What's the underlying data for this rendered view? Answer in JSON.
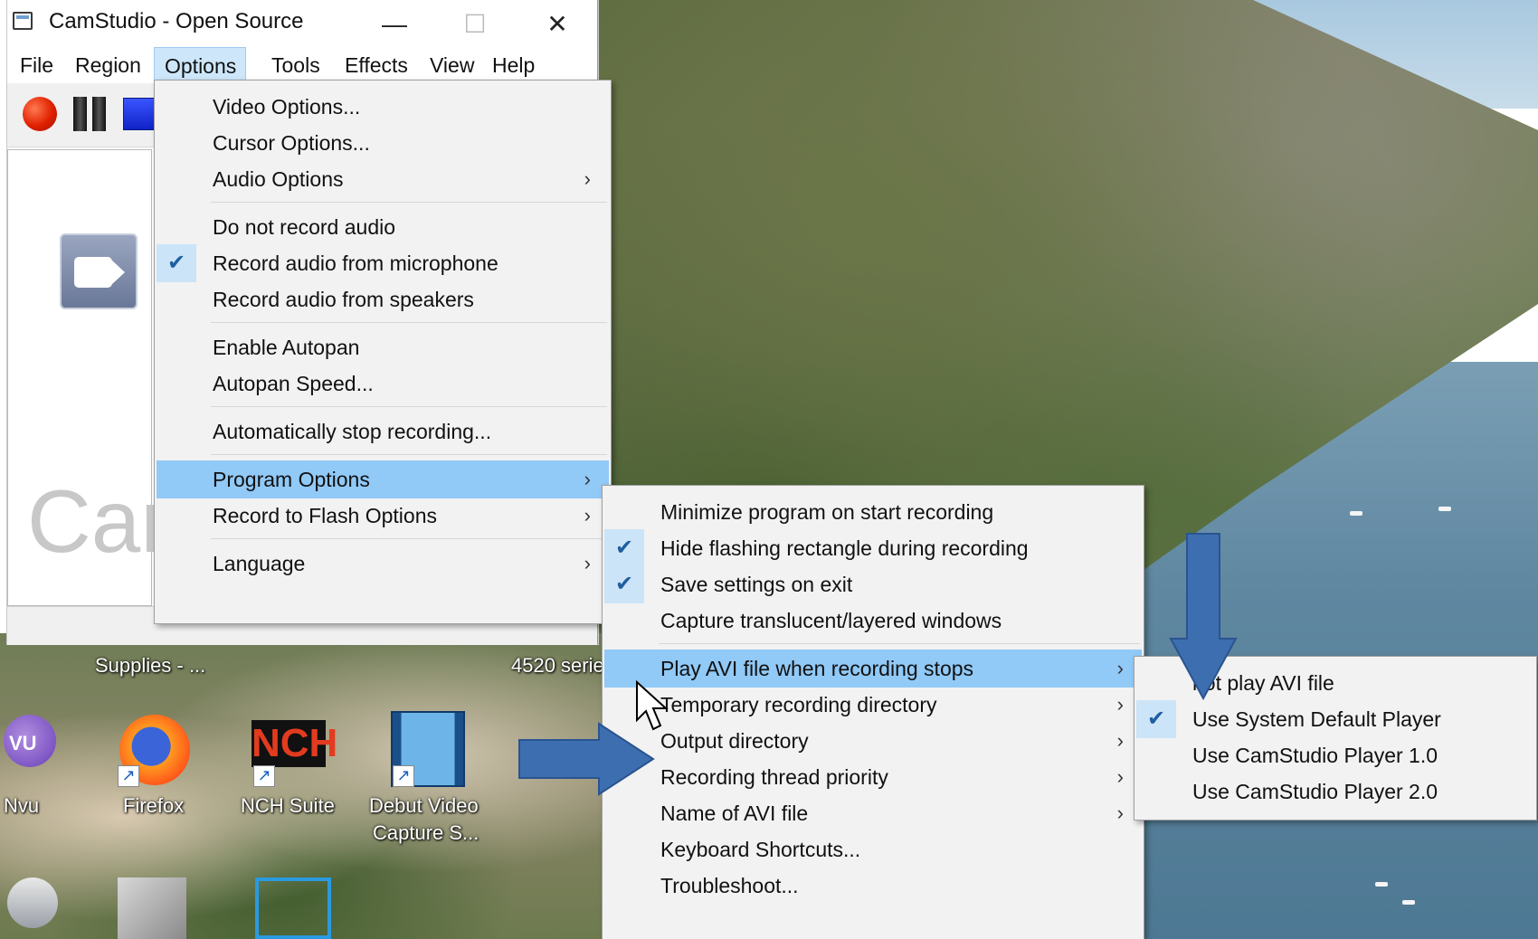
{
  "window": {
    "title": "CamStudio - Open Source",
    "minimize_glyph": "—",
    "maximize_glyph": "☐",
    "close_glyph": "✕"
  },
  "menubar": [
    "File",
    "Region",
    "Options",
    "Tools",
    "Effects",
    "View",
    "Help"
  ],
  "background_text": "Car",
  "desktop": {
    "partial_labels": [
      "Supplies - ...",
      "4520 serie",
      "Nvu",
      "Firefox",
      "NCH Suite",
      "Debut Video",
      "Capture S..."
    ],
    "nch_logo_text": "NCH"
  },
  "options_menu": {
    "items": [
      {
        "label": "Video Options...",
        "checked": false,
        "submenu": false
      },
      {
        "label": "Cursor Options...",
        "checked": false,
        "submenu": false
      },
      {
        "label": "Audio Options",
        "checked": false,
        "submenu": true
      },
      {
        "label": "Do not record audio",
        "checked": false,
        "submenu": false
      },
      {
        "label": "Record audio from microphone",
        "checked": true,
        "submenu": false
      },
      {
        "label": "Record audio from speakers",
        "checked": false,
        "submenu": false
      },
      {
        "label": "Enable Autopan",
        "checked": false,
        "submenu": false
      },
      {
        "label": "Autopan Speed...",
        "checked": false,
        "submenu": false
      },
      {
        "label": "Automatically stop recording...",
        "checked": false,
        "submenu": false
      },
      {
        "label": "Program Options",
        "checked": false,
        "submenu": true,
        "highlighted": true
      },
      {
        "label": "Record to Flash Options",
        "checked": false,
        "submenu": true
      },
      {
        "label": "Language",
        "checked": false,
        "submenu": true
      }
    ]
  },
  "program_options_menu": {
    "items": [
      {
        "label": "Minimize program on start recording",
        "checked": false,
        "submenu": false
      },
      {
        "label": "Hide flashing rectangle during recording",
        "checked": true,
        "submenu": false
      },
      {
        "label": "Save settings on exit",
        "checked": true,
        "submenu": false
      },
      {
        "label": "Capture translucent/layered windows",
        "checked": false,
        "submenu": false
      },
      {
        "label": "Play AVI file when recording stops",
        "checked": false,
        "submenu": true,
        "highlighted": true
      },
      {
        "label": "Temporary recording directory",
        "checked": false,
        "submenu": true
      },
      {
        "label": "Output directory",
        "checked": false,
        "submenu": true
      },
      {
        "label": "Recording thread priority",
        "checked": false,
        "submenu": true
      },
      {
        "label": "Name of AVI file",
        "checked": false,
        "submenu": true
      },
      {
        "label": "Keyboard Shortcuts...",
        "checked": false,
        "submenu": false
      },
      {
        "label": "Troubleshoot...",
        "checked": false,
        "submenu": false
      }
    ]
  },
  "play_avi_menu": {
    "items": [
      {
        "label": "not play AVI file",
        "checked": false
      },
      {
        "label": "Use System Default Player",
        "checked": true
      },
      {
        "label": "Use CamStudio Player 1.0",
        "checked": false
      },
      {
        "label": "Use CamStudio Player 2.0",
        "checked": false
      }
    ]
  },
  "glyphs": {
    "check": "✔",
    "chevron": "›"
  },
  "colors": {
    "highlight": "#91c9f7",
    "arrow": "#3d6fb0",
    "menu_bg": "#f2f2f2"
  }
}
